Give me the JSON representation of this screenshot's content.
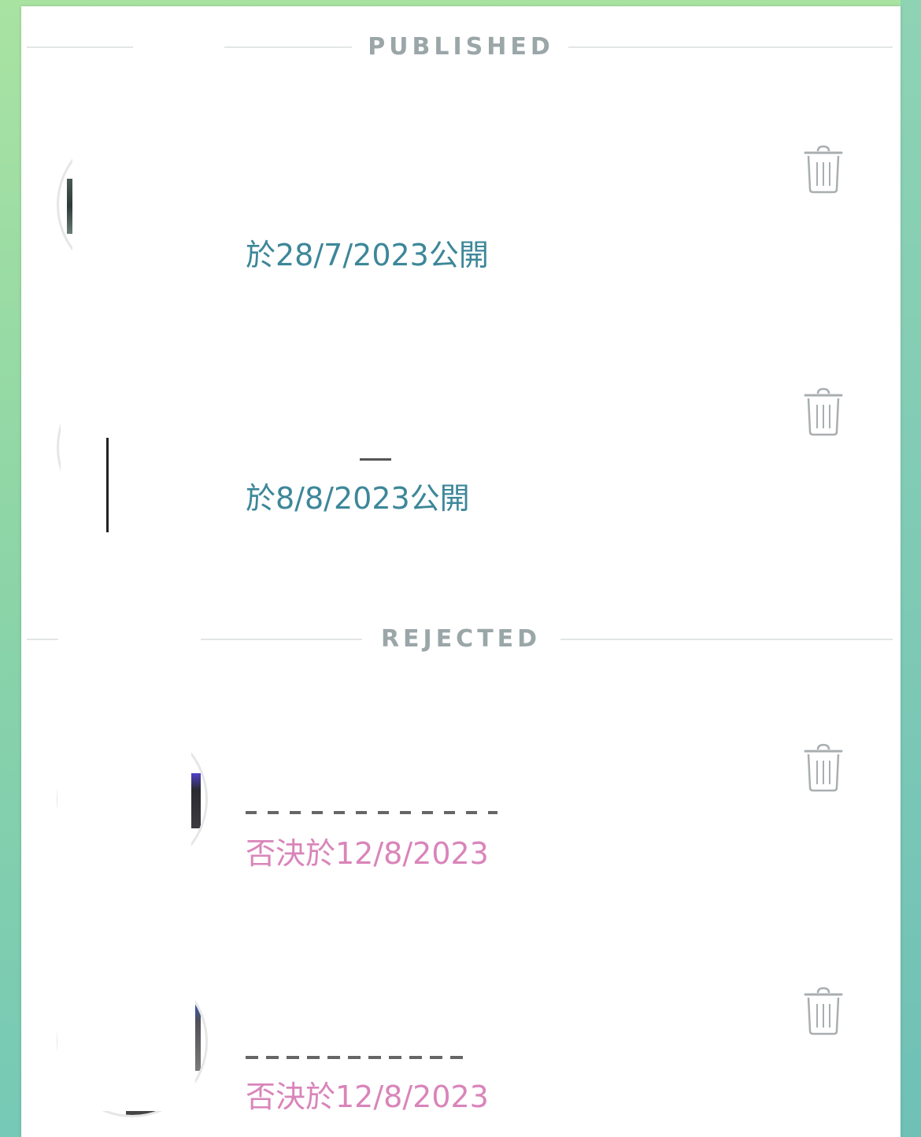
{
  "sections": {
    "published": {
      "title": "PUBLISHED",
      "items": [
        {
          "status_text": "於28/7/2023公開"
        },
        {
          "status_text": "於8/8/2023公開"
        }
      ]
    },
    "rejected": {
      "title": "REJECTED",
      "items": [
        {
          "status_text": "否決於12/8/2023"
        },
        {
          "status_text": "否決於12/8/2023"
        }
      ]
    }
  },
  "icons": {
    "delete": "trash-icon"
  },
  "colors": {
    "published_text": "#3d8799",
    "rejected_text": "#d985ba",
    "section_title": "#9aa6a8",
    "icon_stroke": "#a9aeb0",
    "background_top": "#a9e3a2",
    "background_bottom": "#76c9b6"
  }
}
